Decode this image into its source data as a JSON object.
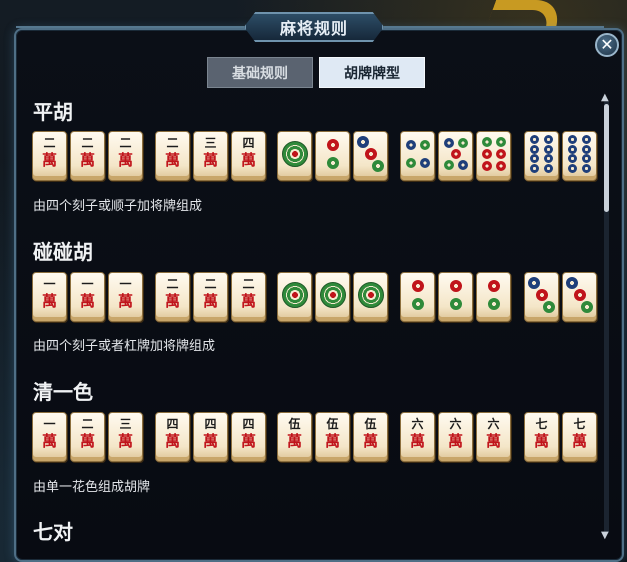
{
  "window": {
    "title": "麻将规则",
    "close_label": "✕"
  },
  "tabs": [
    {
      "label": "基础规则",
      "active": false
    },
    {
      "label": "胡牌牌型",
      "active": true
    }
  ],
  "sections": [
    {
      "title": "平胡",
      "description": "由四个刻子或顺子加将牌组成",
      "tiles": [
        {
          "suit": "wan",
          "rank": "二"
        },
        {
          "suit": "wan",
          "rank": "二"
        },
        {
          "suit": "wan",
          "rank": "二"
        },
        {
          "suit": "wan",
          "rank": "二"
        },
        {
          "suit": "wan",
          "rank": "三"
        },
        {
          "suit": "wan",
          "rank": "四"
        },
        {
          "suit": "tong",
          "rank": 1
        },
        {
          "suit": "tong",
          "rank": 2
        },
        {
          "suit": "tong",
          "rank": 3
        },
        {
          "suit": "tong",
          "rank": 4
        },
        {
          "suit": "tong",
          "rank": 5
        },
        {
          "suit": "tong",
          "rank": 6
        },
        {
          "suit": "tong",
          "rank": 8
        },
        {
          "suit": "tong",
          "rank": 8
        }
      ]
    },
    {
      "title": "碰碰胡",
      "description": "由四个刻子或者杠牌加将牌组成",
      "tiles": [
        {
          "suit": "wan",
          "rank": "一"
        },
        {
          "suit": "wan",
          "rank": "一"
        },
        {
          "suit": "wan",
          "rank": "一"
        },
        {
          "suit": "wan",
          "rank": "二"
        },
        {
          "suit": "wan",
          "rank": "二"
        },
        {
          "suit": "wan",
          "rank": "二"
        },
        {
          "suit": "tong",
          "rank": 1
        },
        {
          "suit": "tong",
          "rank": 1
        },
        {
          "suit": "tong",
          "rank": 1
        },
        {
          "suit": "tong",
          "rank": 2
        },
        {
          "suit": "tong",
          "rank": 2
        },
        {
          "suit": "tong",
          "rank": 2
        },
        {
          "suit": "tong",
          "rank": 3
        },
        {
          "suit": "tong",
          "rank": 3
        }
      ]
    },
    {
      "title": "清一色",
      "description": "由单一花色组成胡牌",
      "tiles": [
        {
          "suit": "wan",
          "rank": "一"
        },
        {
          "suit": "wan",
          "rank": "二"
        },
        {
          "suit": "wan",
          "rank": "三"
        },
        {
          "suit": "wan",
          "rank": "四"
        },
        {
          "suit": "wan",
          "rank": "四"
        },
        {
          "suit": "wan",
          "rank": "四"
        },
        {
          "suit": "wan",
          "rank": "伍"
        },
        {
          "suit": "wan",
          "rank": "伍"
        },
        {
          "suit": "wan",
          "rank": "伍"
        },
        {
          "suit": "wan",
          "rank": "六"
        },
        {
          "suit": "wan",
          "rank": "六"
        },
        {
          "suit": "wan",
          "rank": "六"
        },
        {
          "suit": "wan",
          "rank": "七"
        },
        {
          "suit": "wan",
          "rank": "七"
        }
      ]
    },
    {
      "title": "七对",
      "description": "",
      "tiles": []
    }
  ],
  "wan_character": "萬",
  "colors": {
    "wan_red": "#c0141b",
    "dot_green": "#2f8a3a",
    "dot_red": "#c0141b",
    "dot_blue": "#1f3f7a"
  }
}
